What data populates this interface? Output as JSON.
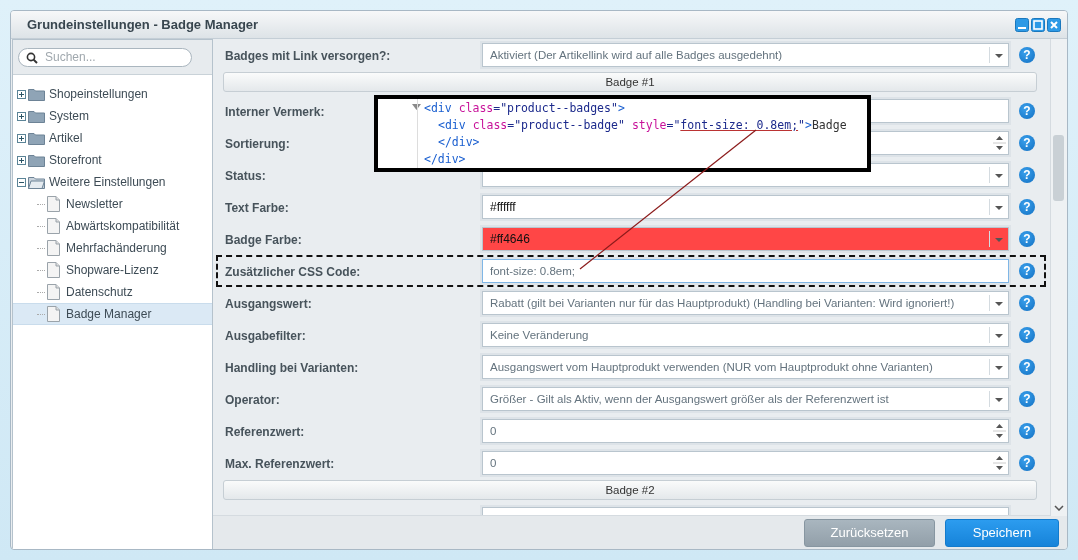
{
  "window": {
    "title": "Grundeinstellungen - Badge Manager"
  },
  "sidebar": {
    "search": {
      "placeholder": "Suchen..."
    },
    "tree": [
      {
        "label": "Shopeinstellungen",
        "expanded": false,
        "selected": false
      },
      {
        "label": "System",
        "expanded": false,
        "selected": false
      },
      {
        "label": "Artikel",
        "expanded": false,
        "selected": false
      },
      {
        "label": "Storefront",
        "expanded": false,
        "selected": false
      },
      {
        "label": "Weitere Einstellungen",
        "expanded": true,
        "selected": false,
        "children": [
          {
            "label": "Newsletter",
            "selected": false
          },
          {
            "label": "Abwärtskompatibilität",
            "selected": false
          },
          {
            "label": "Mehrfachänderung",
            "selected": false
          },
          {
            "label": "Shopware-Lizenz",
            "selected": false
          },
          {
            "label": "Datenschutz",
            "selected": false
          },
          {
            "label": "Badge Manager",
            "selected": true
          }
        ]
      }
    ]
  },
  "form": {
    "items": [
      {
        "kind": "select",
        "label": "Badges mit Link versorgen?:",
        "value": "Aktiviert (Der Artikellink wird auf alle Badges ausgedehnt)",
        "focused": false,
        "highlighted": false,
        "help": "?"
      },
      {
        "kind": "section",
        "label": "Badge #1"
      },
      {
        "kind": "text",
        "label": "Interner Vermerk:",
        "focused": false,
        "highlighted": false,
        "help": "?"
      },
      {
        "kind": "number",
        "label": "Sortierung:",
        "focused": false,
        "highlighted": false,
        "help": "?"
      },
      {
        "kind": "select",
        "label": "Status:",
        "focused": false,
        "highlighted": false,
        "help": "?"
      },
      {
        "kind": "color",
        "label": "Text Farbe:",
        "value": "#ffffff",
        "color": "#ffffff",
        "focused": false,
        "highlighted": false,
        "help": "?"
      },
      {
        "kind": "color",
        "label": "Badge Farbe:",
        "value": "#ff4646",
        "color": "#ff4646",
        "focused": false,
        "highlighted": false,
        "help": "?"
      },
      {
        "kind": "text",
        "label": "Zusätzlicher CSS Code:",
        "value": "font-size: 0.8em;",
        "focused": true,
        "highlighted": true,
        "help": "?"
      },
      {
        "kind": "select",
        "label": "Ausgangswert:",
        "value": "Rabatt (gilt bei Varianten nur für das Hauptprodukt) (Handling bei Varianten: Wird ignoriert!)",
        "focused": false,
        "highlighted": false,
        "help": "?"
      },
      {
        "kind": "select",
        "label": "Ausgabefilter:",
        "value": "Keine Veränderung",
        "focused": false,
        "highlighted": false,
        "help": "?"
      },
      {
        "kind": "select",
        "label": "Handling bei Varianten:",
        "value": "Ausgangswert vom Hauptprodukt verwenden (NUR vom Hauptprodukt ohne Varianten)",
        "focused": false,
        "highlighted": false,
        "help": "?"
      },
      {
        "kind": "select",
        "label": "Operator:",
        "value": "Größer - Gilt als Aktiv, wenn der Ausgangswert größer als der Referenzwert ist",
        "focused": false,
        "highlighted": false,
        "help": "?"
      },
      {
        "kind": "number",
        "label": "Referenzwert:",
        "value": "0",
        "focused": false,
        "highlighted": false,
        "help": "?"
      },
      {
        "kind": "number",
        "label": "Max. Referenzwert:",
        "value": "0",
        "focused": false,
        "highlighted": false,
        "help": "?"
      },
      {
        "kind": "section",
        "label": "Badge #2"
      },
      {
        "kind": "text",
        "focused": false,
        "highlighted": false
      }
    ]
  },
  "code_view": {
    "nodes": [
      {
        "expanded": true,
        "open": [
          {
            "kind": "tag",
            "text": "<div"
          },
          {
            "kind": "attr",
            "text": " class"
          },
          {
            "kind": "value",
            "text": "=\"product--badges\""
          },
          {
            "kind": "tag",
            "text": ">"
          }
        ],
        "children": [
          {
            "open": [
              {
                "kind": "tag",
                "text": "<div"
              },
              {
                "kind": "attr",
                "text": " class"
              },
              {
                "kind": "value",
                "text": "=\"product--badge\""
              },
              {
                "kind": "attr",
                "text": " style"
              },
              {
                "kind": "value",
                "text": "=\""
              },
              {
                "kind": "marked",
                "text": "font-size: 0.8em;"
              },
              {
                "kind": "value",
                "text": "\""
              },
              {
                "kind": "tag",
                "text": ">"
              },
              {
                "kind": "text",
                "text": "Badge"
              }
            ],
            "close": "</div>"
          }
        ],
        "close": "</div>"
      }
    ]
  },
  "footer": {
    "buttons": [
      {
        "label": "Zurücksetzen",
        "kind": "secondary"
      },
      {
        "label": "Speichern",
        "kind": "primary"
      }
    ]
  }
}
